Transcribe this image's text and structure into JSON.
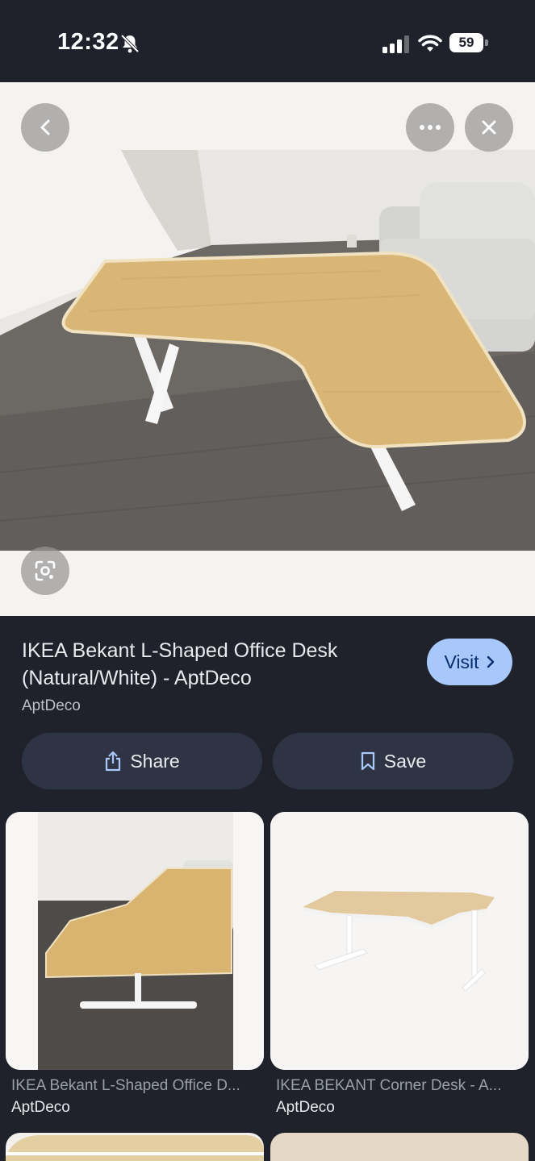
{
  "status_bar": {
    "time": "12:32",
    "battery_level": "59",
    "icons": [
      "bell-off-icon",
      "cellular-signal-icon",
      "wifi-icon",
      "battery-icon"
    ]
  },
  "viewer": {
    "image_alt": "IKEA Bekant L-shaped desk with natural birch top and white legs in a living room",
    "buttons": [
      "back-icon",
      "more-icon",
      "close-icon",
      "lens-icon"
    ]
  },
  "result": {
    "title": "IKEA Bekant L-Shaped Office Desk (Natural/White) - AptDeco",
    "source": "AptDeco",
    "visit_label": "Visit",
    "share_label": "Share",
    "save_label": "Save"
  },
  "related": [
    {
      "title": "IKEA Bekant L-Shaped Office D...",
      "source": "AptDeco"
    },
    {
      "title": "IKEA BEKANT Corner Desk - A...",
      "source": "AptDeco"
    }
  ],
  "colors": {
    "background": "#1f212b",
    "viewer_background": "#f6f2ef",
    "visit_button": "#a8c7fa",
    "action_button": "#2f3445"
  }
}
